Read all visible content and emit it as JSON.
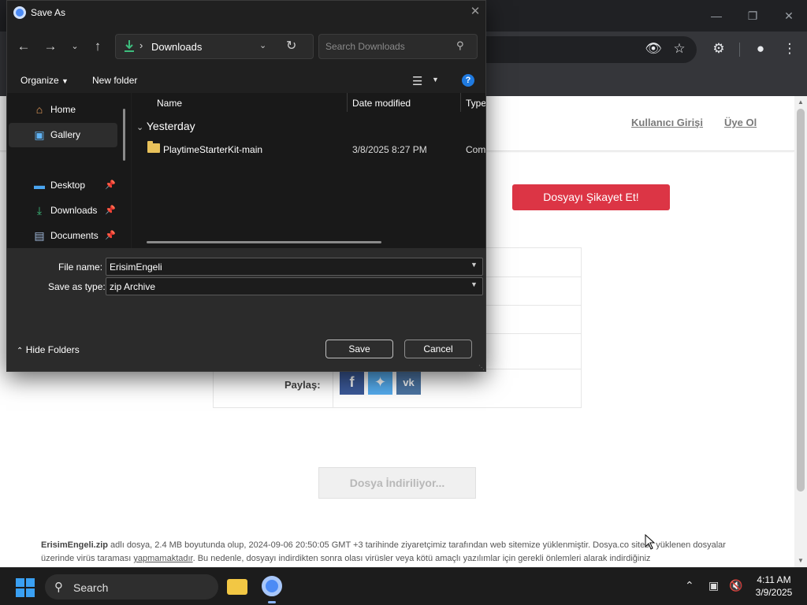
{
  "dialog": {
    "title": "Save As",
    "address": "Downloads",
    "search_placeholder": "Search Downloads",
    "toolbar": {
      "organize": "Organize",
      "new_folder": "New folder"
    },
    "nav": [
      {
        "label": "Home",
        "icon": "home-icon"
      },
      {
        "label": "Gallery",
        "icon": "gallery-icon"
      },
      {
        "label": "Desktop",
        "icon": "desktop-icon"
      },
      {
        "label": "Downloads",
        "icon": "download-icon"
      },
      {
        "label": "Documents",
        "icon": "documents-icon"
      }
    ],
    "columns": {
      "name": "Name",
      "date": "Date modified",
      "type": "Type"
    },
    "group": "Yesterday",
    "files": [
      {
        "name": "PlaytimeStarterKit-main",
        "date": "3/8/2025 8:27 PM",
        "type": "Com"
      }
    ],
    "file_name_label": "File name:",
    "file_name_value": "ErisimEngeli",
    "save_type_label": "Save as type:",
    "save_type_value": "zip Archive",
    "hide_folders": "Hide Folders",
    "save_label": "Save",
    "cancel_label": "Cancel"
  },
  "site": {
    "login": "Kullanıcı Girişi",
    "signup": "Üye Ol",
    "report_button": "Dosyayı Şikayet Et!",
    "share_label": "Paylaş:",
    "download_button": "Dosya İndiriliyor...",
    "footer": {
      "filename": "ErisimEngeli.zip",
      "part1": " adlı dosya, 2.4 MB boyutunda olup, 2024-09-06 20:50:05 GMT +3 tarihinde ziyaretçimiz tarafından web sitemize yüklenmiştir. Dosya.co sitesi, yüklenen dosyalar üzerinde virüs taraması ",
      "underlined": "yapmamaktadır",
      "part2": ". Bu nedenle, dosyayı indirdikten sonra olası virüsler veya kötü amaçlı yazılımlar için gerekli önlemleri alarak indirdiğiniz"
    }
  },
  "taskbar": {
    "search_label": "Search",
    "time": "4:11 AM",
    "date": "3/9/2025"
  },
  "colors": {
    "accent_red": "#dc3545",
    "facebook": "#3b5998",
    "twitter": "#55acee",
    "vk": "#4c75a3",
    "windows_blue": "#3aa0f3"
  }
}
